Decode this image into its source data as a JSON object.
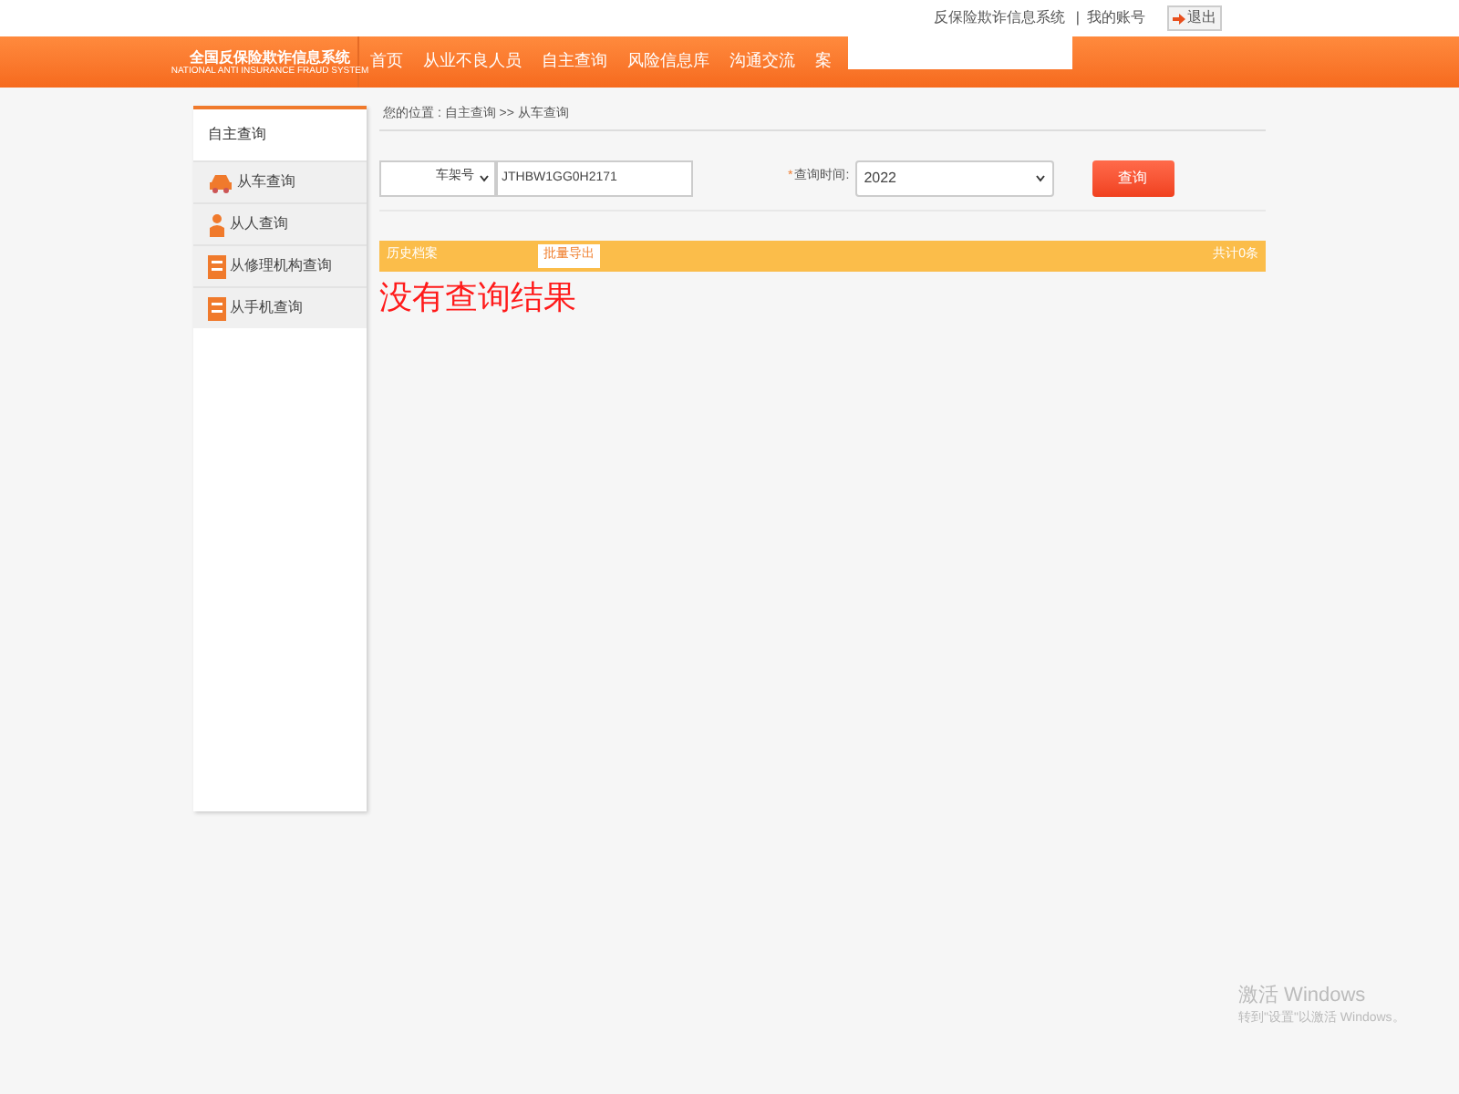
{
  "top_bar": {
    "system_name": "反保险欺诈信息系统",
    "separator": "|",
    "account": "我的账号",
    "logout": "退出"
  },
  "header": {
    "logo_title": "全国反保险欺诈信息系统",
    "logo_subtitle": "NATIONAL ANTI INSURANCE FRAUD SYSTEM",
    "nav": [
      {
        "label": "首页"
      },
      {
        "label": "从业不良人员"
      },
      {
        "label": "自主查询"
      },
      {
        "label": "风险信息库"
      },
      {
        "label": "沟通交流"
      },
      {
        "label": "案"
      }
    ]
  },
  "sidebar": {
    "title": "自主查询",
    "items": [
      {
        "label": "从车查询",
        "kind": "car"
      },
      {
        "label": "从人查询",
        "kind": "person"
      },
      {
        "label": "从修理机构查询",
        "kind": "doc"
      },
      {
        "label": "从手机查询",
        "kind": "doc"
      }
    ]
  },
  "breadcrumb": "您的位置 : 自主查询 >> 从车查询",
  "form": {
    "type_select": "车架号",
    "query_value": "JTHBW1GG0H2171",
    "required_mark": "*",
    "time_label": "查询时间:",
    "time_select": "2022",
    "search_button": "查询"
  },
  "results": {
    "title": "历史档案",
    "export_button": "批量导出",
    "count": "共计0条",
    "empty_message": "没有查询结果"
  },
  "os_notice": {
    "title": "激活 Windows",
    "text": "转到\"设置\"以激活 Windows。"
  }
}
